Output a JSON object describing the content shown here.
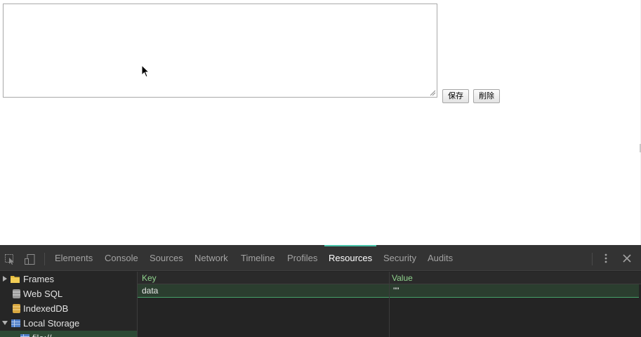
{
  "page": {
    "textarea_value": "",
    "save_button": "保存",
    "delete_button": "削除"
  },
  "devtools": {
    "tabs": [
      {
        "label": "Elements"
      },
      {
        "label": "Console"
      },
      {
        "label": "Sources"
      },
      {
        "label": "Network"
      },
      {
        "label": "Timeline"
      },
      {
        "label": "Profiles"
      },
      {
        "label": "Resources",
        "active": true
      },
      {
        "label": "Security"
      },
      {
        "label": "Audits"
      }
    ],
    "sidebar": [
      {
        "label": "Frames",
        "icon": "folder-icon",
        "expanded": false
      },
      {
        "label": "Web SQL",
        "icon": "database-icon"
      },
      {
        "label": "IndexedDB",
        "icon": "database-icon"
      },
      {
        "label": "Local Storage",
        "icon": "table-icon",
        "expanded": true
      },
      {
        "label": "file://",
        "icon": "table-icon",
        "selected": true
      }
    ],
    "grid": {
      "columns": [
        "Key",
        "Value"
      ],
      "rows": [
        {
          "key": "data",
          "value": "\"\""
        }
      ]
    },
    "colors": {
      "accent": "#47c2a8",
      "selected_row": "#2b3e2f",
      "header_text": "#8fd38d"
    }
  }
}
